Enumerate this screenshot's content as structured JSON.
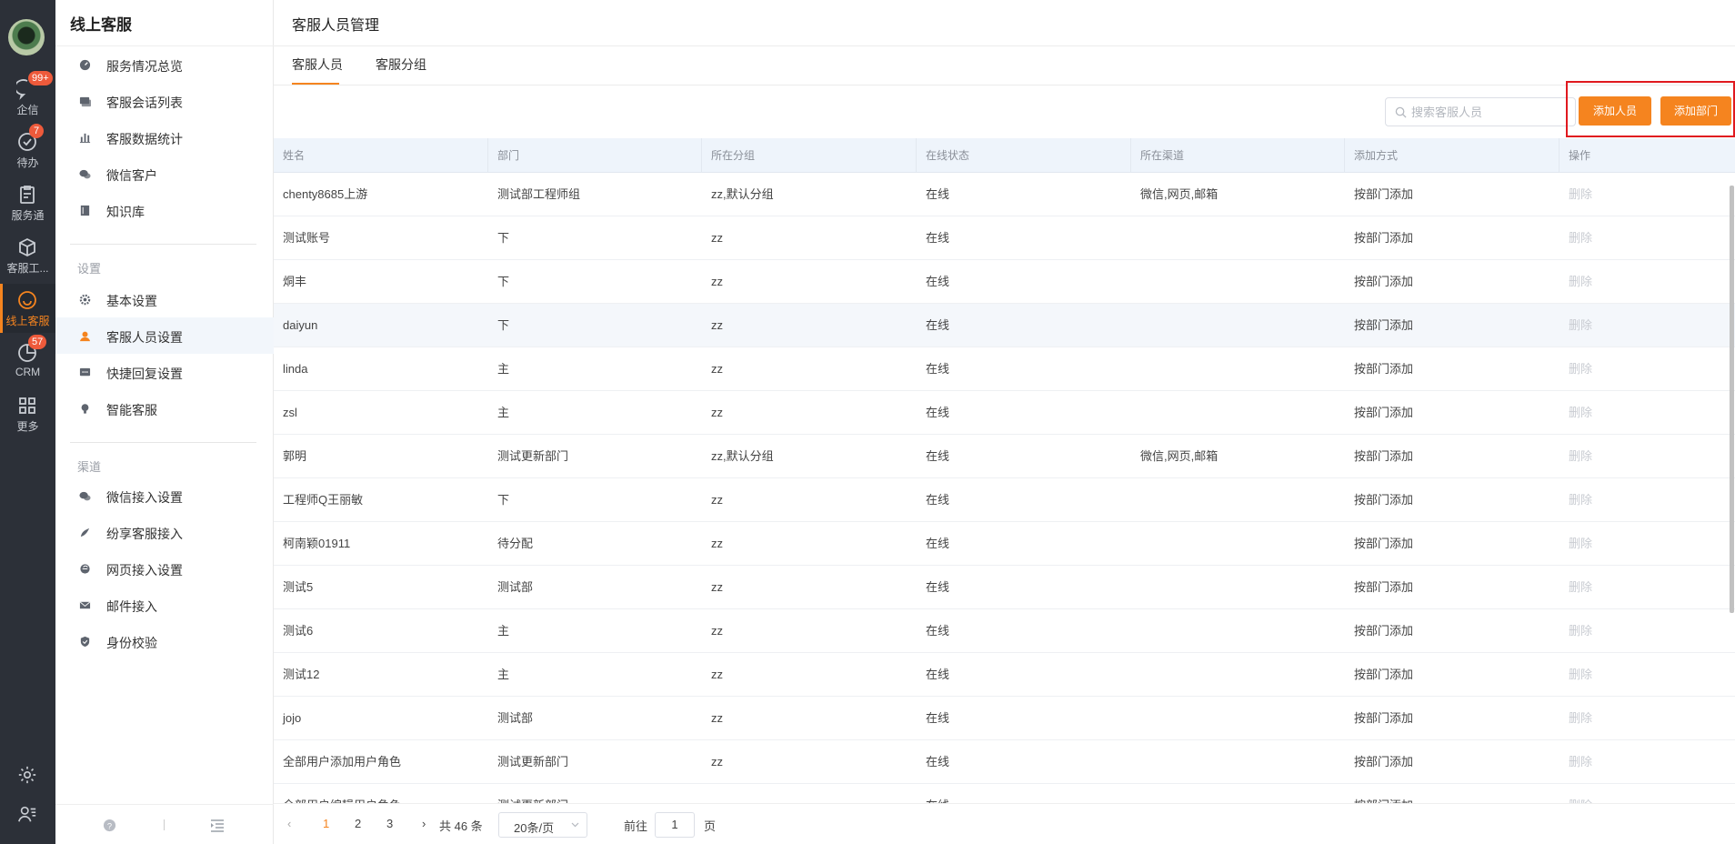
{
  "rail": {
    "items": [
      {
        "label": "企信",
        "badge": "99+"
      },
      {
        "label": "待办",
        "badge": "7"
      },
      {
        "label": "服务通",
        "badge": ""
      },
      {
        "label": "客服工...",
        "badge": ""
      },
      {
        "label": "线上客服",
        "badge": ""
      },
      {
        "label": "CRM",
        "badge": "57"
      },
      {
        "label": "更多",
        "badge": ""
      }
    ]
  },
  "sidebar": {
    "title": "线上客服",
    "items": [
      {
        "label": "服务情况总览"
      },
      {
        "label": "客服会话列表"
      },
      {
        "label": "客服数据统计"
      },
      {
        "label": "微信客户"
      },
      {
        "label": "知识库"
      }
    ],
    "settings_group": "设置",
    "settings_items": [
      {
        "label": "基本设置"
      },
      {
        "label": "客服人员设置"
      },
      {
        "label": "快捷回复设置"
      },
      {
        "label": "智能客服"
      }
    ],
    "channel_group": "渠道",
    "channel_items": [
      {
        "label": "微信接入设置"
      },
      {
        "label": "纷享客服接入"
      },
      {
        "label": "网页接入设置"
      },
      {
        "label": "邮件接入"
      },
      {
        "label": "身份校验"
      }
    ]
  },
  "main": {
    "title": "客服人员管理",
    "tabs": [
      {
        "label": "客服人员"
      },
      {
        "label": "客服分组"
      }
    ],
    "search_placeholder": "搜索客服人员",
    "add_member_label": "添加人员",
    "add_dept_label": "添加部门"
  },
  "table": {
    "headers": [
      "姓名",
      "部门",
      "所在分组",
      "在线状态",
      "所在渠道",
      "添加方式",
      "操作"
    ],
    "rows": [
      [
        "chenty8685上游",
        "测试部工程师组",
        "zz,默认分组",
        "在线",
        "微信,网页,邮箱",
        "按部门添加",
        "删除"
      ],
      [
        "测试账号",
        "下",
        "zz",
        "在线",
        "",
        "按部门添加",
        "删除"
      ],
      [
        "烔丰",
        "下",
        "zz",
        "在线",
        "",
        "按部门添加",
        "删除"
      ],
      [
        "daiyun",
        "下",
        "zz",
        "在线",
        "",
        "按部门添加",
        "删除"
      ],
      [
        "linda",
        "主",
        "zz",
        "在线",
        "",
        "按部门添加",
        "删除"
      ],
      [
        "zsl",
        "主",
        "zz",
        "在线",
        "",
        "按部门添加",
        "删除"
      ],
      [
        "郭明",
        "测试更新部门",
        "zz,默认分组",
        "在线",
        "微信,网页,邮箱",
        "按部门添加",
        "删除"
      ],
      [
        "工程师Q王丽敏",
        "下",
        "zz",
        "在线",
        "",
        "按部门添加",
        "删除"
      ],
      [
        "柯南颖01911",
        "待分配",
        "zz",
        "在线",
        "",
        "按部门添加",
        "删除"
      ],
      [
        "测试5",
        "测试部",
        "zz",
        "在线",
        "",
        "按部门添加",
        "删除"
      ],
      [
        "测试6",
        "主",
        "zz",
        "在线",
        "",
        "按部门添加",
        "删除"
      ],
      [
        "测试12",
        "主",
        "zz",
        "在线",
        "",
        "按部门添加",
        "删除"
      ],
      [
        "jojo",
        "测试部",
        "zz",
        "在线",
        "",
        "按部门添加",
        "删除"
      ],
      [
        "全部用户添加用户角色",
        "测试更新部门",
        "zz",
        "在线",
        "",
        "按部门添加",
        "删除"
      ],
      [
        "全部用户编辑用户角色",
        "测试更新部门",
        "zz",
        "在线",
        "",
        "按部门添加",
        "删除"
      ]
    ]
  },
  "pager": {
    "pages": [
      "1",
      "2",
      "3"
    ],
    "total_text": "共 46 条",
    "page_size": "20条/页",
    "goto_label": "前往",
    "goto_value": "1",
    "page_unit": "页"
  },
  "colors": {
    "accent": "#f5841f",
    "rail_bg": "#2c3038",
    "badge": "#ee5a3b",
    "highlight_box": "#e0191f"
  }
}
